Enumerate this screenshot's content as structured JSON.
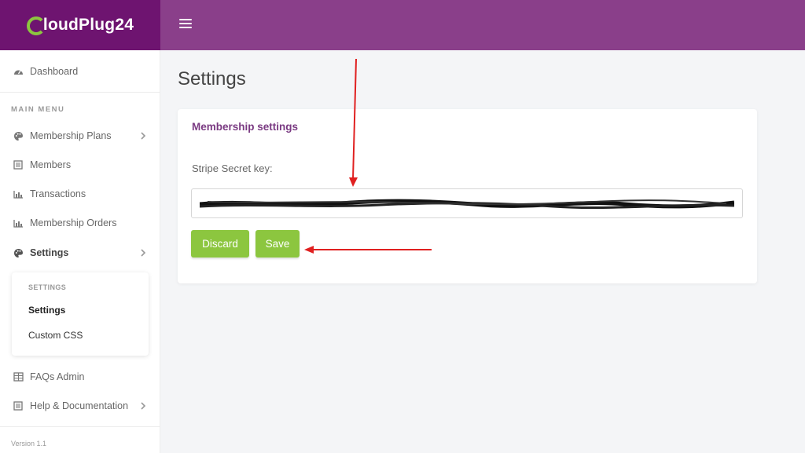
{
  "brand": {
    "name": "loudPlug24",
    "logo_letter": "C"
  },
  "header": {
    "menu_icon": "hamburger-icon"
  },
  "sidebar": {
    "dashboard": {
      "label": "Dashboard",
      "icon": "dashboard-gauge-icon"
    },
    "section_title": "MAIN MENU",
    "items": [
      {
        "label": "Membership Plans",
        "icon": "palette-icon",
        "has_chevron": true
      },
      {
        "label": "Members",
        "icon": "list-icon"
      },
      {
        "label": "Transactions",
        "icon": "bar-chart-icon"
      },
      {
        "label": "Membership Orders",
        "icon": "bar-chart-icon"
      },
      {
        "label": "Settings",
        "icon": "palette-icon",
        "has_chevron": true,
        "active": true
      },
      {
        "label": "FAQs Admin",
        "icon": "table-icon"
      },
      {
        "label": "Help & Documentation",
        "icon": "list-icon",
        "has_chevron": true
      }
    ],
    "submenu": {
      "title": "SETTINGS",
      "items": [
        {
          "label": "Settings",
          "active": true
        },
        {
          "label": "Custom CSS"
        }
      ]
    },
    "version": "Version 1.1"
  },
  "main": {
    "page_title": "Settings",
    "card": {
      "title": "Membership settings",
      "field_label": "Stripe Secret key:",
      "field_value": "",
      "buttons": {
        "discard": "Discard",
        "save": "Save"
      }
    }
  },
  "colors": {
    "brand_bg": "#6e1470",
    "header_bg": "#8a3f8a",
    "accent_green": "#8cc63f",
    "card_title": "#7a3a82",
    "annotation_red": "#e02020"
  }
}
